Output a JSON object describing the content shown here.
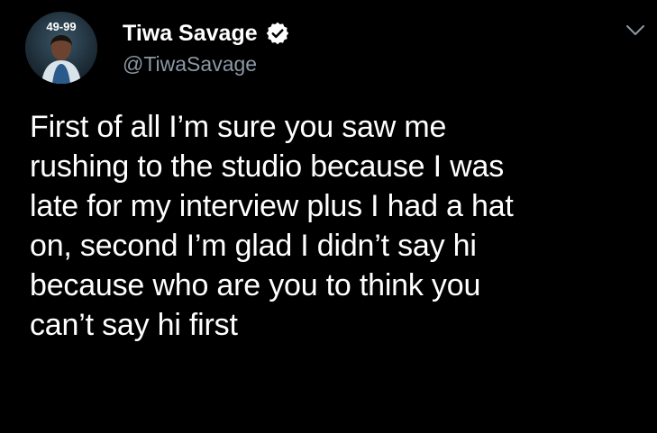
{
  "colors": {
    "background": "#000000",
    "text_primary": "#ffffff",
    "text_secondary": "#8b98a5",
    "verified_badge": "#ffffff"
  },
  "author": {
    "avatar_badge_text": "49-99",
    "display_name": "Tiwa Savage",
    "verified_icon": "verified-badge-icon",
    "handle": "@TiwaSavage"
  },
  "header": {
    "menu_icon": "chevron-down-icon"
  },
  "tweet": {
    "text": "First of all I’m sure you saw me\nrushing to the studio because I was\nlate for my interview plus I had a hat\non, second I’m glad I didn’t say hi\nbecause who are you to think you\ncan’t say hi first"
  }
}
